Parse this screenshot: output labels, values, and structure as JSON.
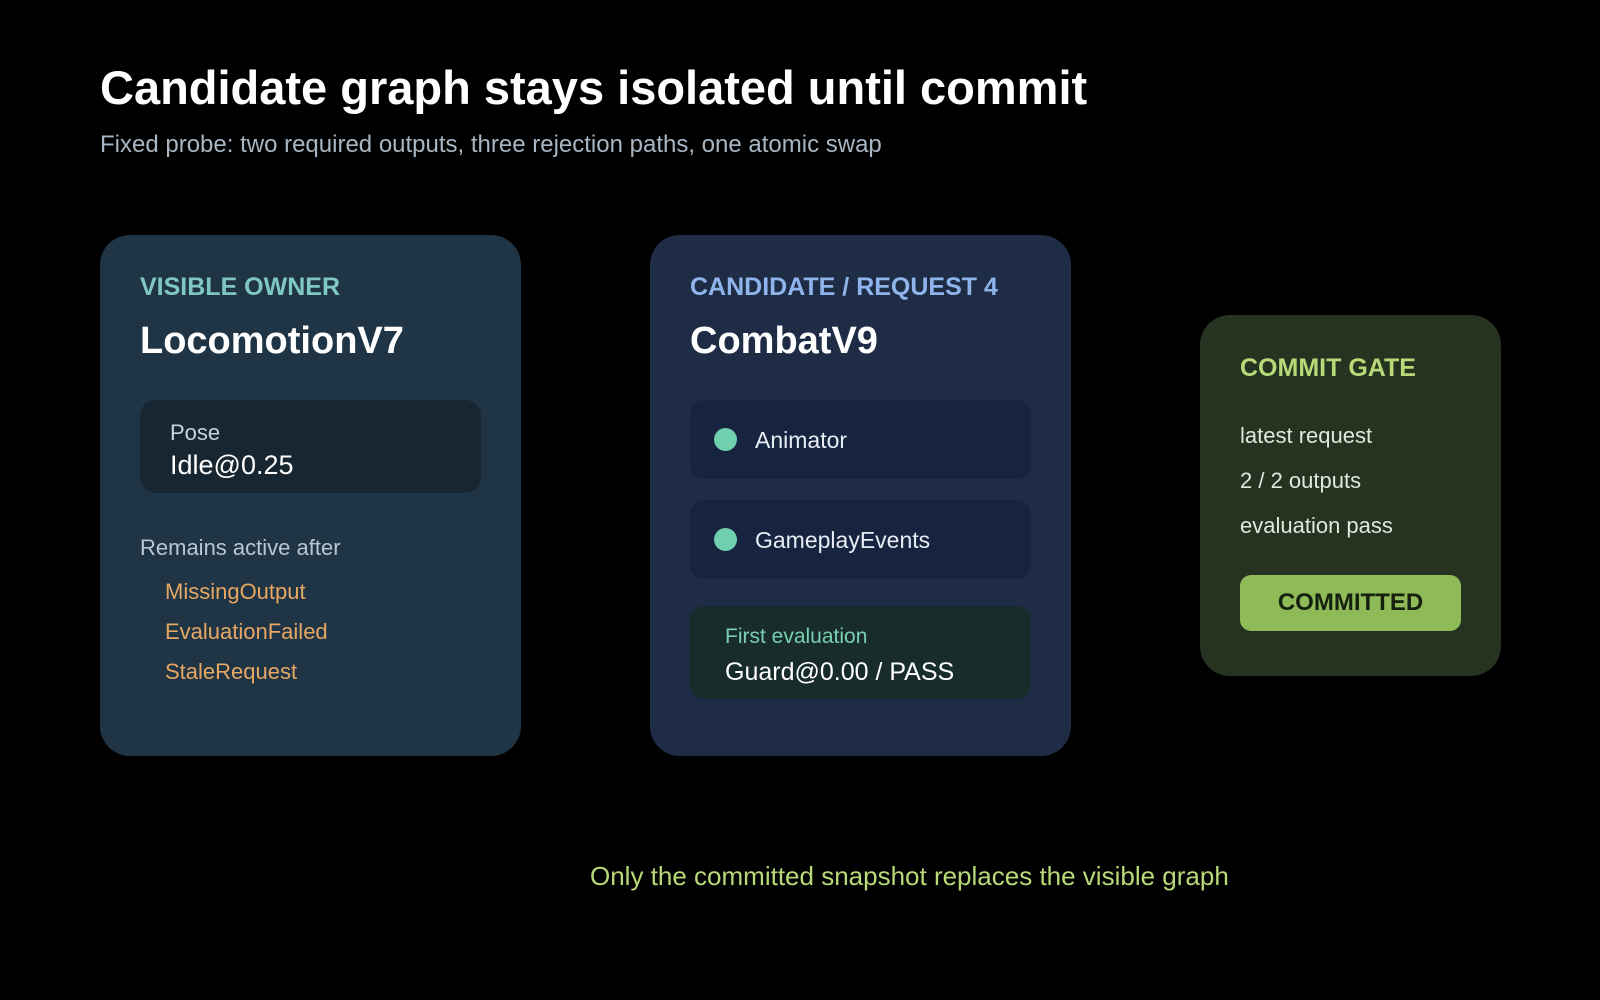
{
  "header": {
    "title": "Candidate graph stays isolated until commit",
    "subtitle": "Fixed probe: two required outputs, three rejection paths, one atomic swap"
  },
  "visible_owner": {
    "eyebrow": "VISIBLE OWNER",
    "name": "LocomotionV7",
    "pose_label": "Pose",
    "pose_value": "Idle@0.25",
    "remains_label": "Remains active after",
    "reasons": [
      "MissingOutput",
      "EvaluationFailed",
      "StaleRequest"
    ]
  },
  "candidate": {
    "eyebrow": "CANDIDATE / REQUEST 4",
    "name": "CombatV9",
    "outputs": [
      {
        "label": "Animator",
        "status_color": "#6fcfae"
      },
      {
        "label": "GameplayEvents",
        "status_color": "#6fcfae"
      }
    ],
    "evaluation_label": "First evaluation",
    "evaluation_value": "Guard@0.00 / PASS"
  },
  "commit_gate": {
    "eyebrow": "COMMIT GATE",
    "checks": [
      "latest request",
      "2 / 2 outputs",
      "evaluation pass"
    ],
    "button_label": "COMMITTED"
  },
  "footer": {
    "note": "Only the committed snapshot replaces the visible graph"
  },
  "colors": {
    "background": "#000000",
    "owner_accent": "#7ec7c2",
    "candidate_accent": "#8fb4ec",
    "gate_accent": "#b7d978",
    "reason_color": "#e6a764",
    "status_ok": "#6fcfae"
  }
}
